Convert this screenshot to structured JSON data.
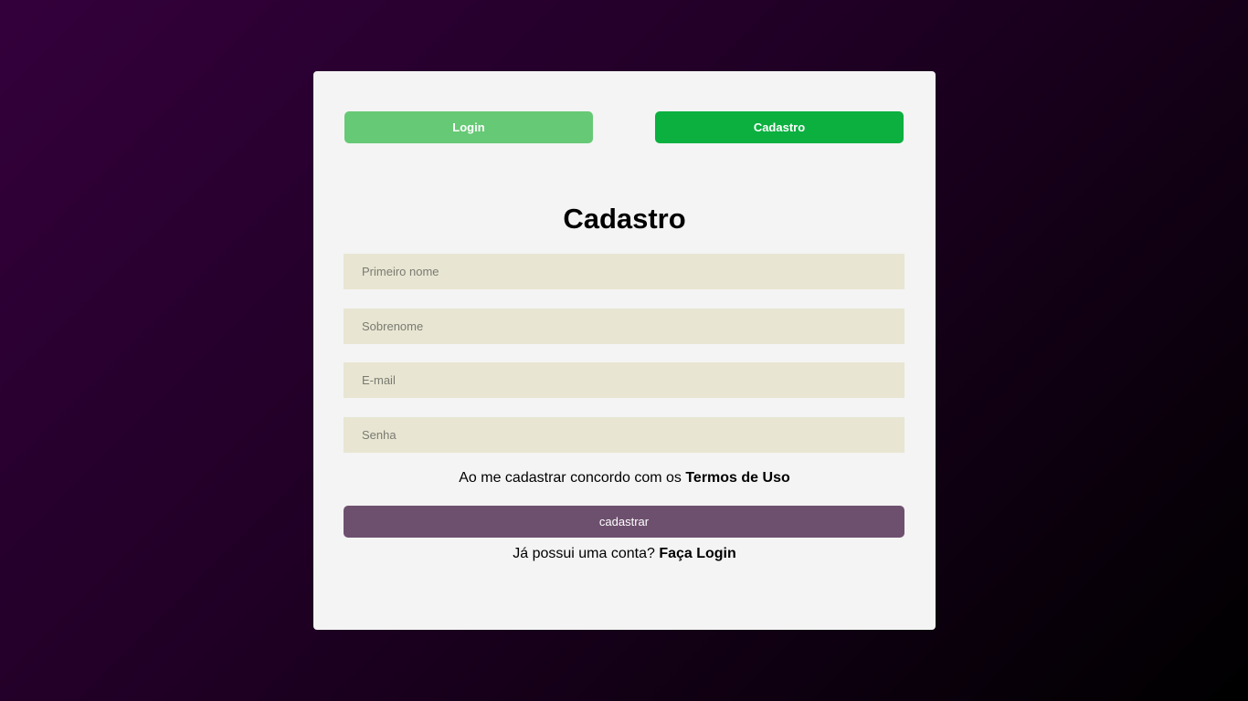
{
  "tabs": {
    "login_label": "Login",
    "cadastro_label": "Cadastro"
  },
  "form": {
    "title": "Cadastro",
    "first_name_placeholder": "Primeiro nome",
    "last_name_placeholder": "Sobrenome",
    "email_placeholder": "E-mail",
    "password_placeholder": "Senha",
    "terms_text": "Ao me cadastrar concordo com os ",
    "terms_link": "Termos de Uso",
    "submit_label": "cadastrar",
    "have_account_text": "Já possui uma conta? ",
    "login_link": "Faça Login"
  },
  "colors": {
    "login_tab": "#66c975",
    "cadastro_tab": "#0bb03f",
    "submit_button": "#6d506e",
    "input_background": "#e8e6d2"
  }
}
